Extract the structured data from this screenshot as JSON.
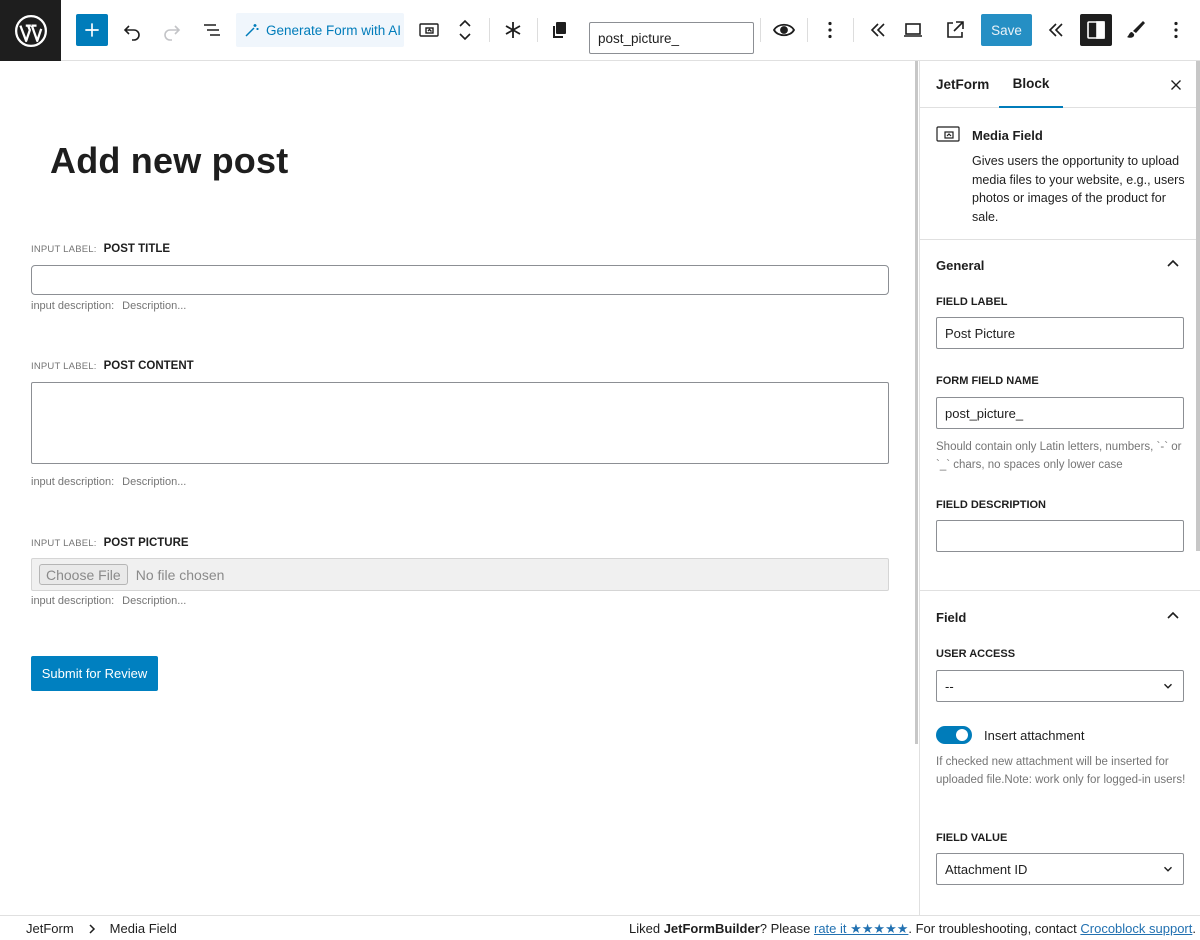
{
  "toolbar": {
    "ai_button_label": "Generate Form with AI",
    "form_name_value": "post_picture_",
    "save_label": "Save"
  },
  "canvas": {
    "page_title": "Add new post",
    "input_label_prefix": "INPUT LABEL:",
    "description_prefix": "input description:",
    "description_placeholder": "Description...",
    "fields": [
      {
        "label": "POST TITLE"
      },
      {
        "label": "POST CONTENT"
      },
      {
        "label": "POST PICTURE"
      }
    ],
    "file_choose_label": "Choose File",
    "file_none_label": "No file chosen",
    "submit_label": "Submit for Review"
  },
  "sidebar": {
    "tabs": [
      {
        "label": "JetForm"
      },
      {
        "label": "Block"
      }
    ],
    "block": {
      "title": "Media Field",
      "description": "Gives users the opportunity to upload media files to your website, e.g., users photos or images of the product for sale."
    },
    "general": {
      "title": "General",
      "field_label_title": "FIELD LABEL",
      "field_label_value": "Post Picture",
      "form_field_name_title": "FORM FIELD NAME",
      "form_field_name_value": "post_picture_",
      "form_field_name_help": "Should contain only Latin letters, numbers, `-` or `_` chars, no spaces only lower case",
      "field_description_title": "FIELD DESCRIPTION",
      "field_description_value": ""
    },
    "field": {
      "title": "Field",
      "user_access_title": "USER ACCESS",
      "user_access_value": "--",
      "insert_attachment_label": "Insert attachment",
      "insert_attachment_on": true,
      "insert_attachment_help": "If checked new attachment will be inserted for uploaded file.Note: work only for logged-in users!",
      "field_value_title": "FIELD VALUE",
      "field_value_value": "Attachment ID"
    }
  },
  "footer": {
    "breadcrumb": [
      "JetForm",
      "Media Field"
    ],
    "rating_prefix": "Liked ",
    "rating_brand": "JetFormBuilder",
    "rating_mid": "? Please ",
    "rating_link": "rate it ★★★★★",
    "rating_mid2": ". For troubleshooting, contact ",
    "support_link": "Crocoblock support",
    "rating_end": "."
  },
  "colors": {
    "accent": "#007cba",
    "dark": "#1e1e1e",
    "border": "#e0e0e0"
  }
}
